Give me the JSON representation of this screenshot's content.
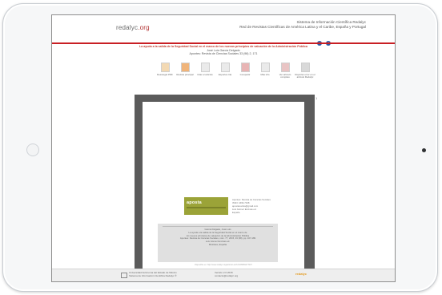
{
  "header": {
    "logo_prefix": "redalyc",
    "logo_suffix": ".org",
    "title_lines": [
      "Sistema de Información Científica Redalyc",
      "Red de Revistas Científicas de América Latina y el Caribe, España y Portugal"
    ],
    "social": [
      "t",
      "f"
    ]
  },
  "article": {
    "highlight": "La ayuda a la salida de la Seguridad Social en el marco de los nuevos principios de valuación de la Administración Pública",
    "author": "José Luis García Delgado",
    "source": "Apuntes: Revista de Ciencias Sociales 33 (98) 2, 171"
  },
  "toolbar": {
    "items": [
      {
        "label": "Descargar PDF",
        "icon": "pdf-download-icon"
      },
      {
        "label": "Revista principal",
        "icon": "journal-icon"
      },
      {
        "label": "Citar el artículo",
        "icon": "cite-icon"
      },
      {
        "label": "Exportar cita",
        "icon": "export-icon"
      },
      {
        "label": "Compartir",
        "icon": "share-icon"
      },
      {
        "label": "Más info",
        "icon": "info-icon"
      },
      {
        "label": "Ver artículo completo",
        "icon": "document-icon"
      },
      {
        "label": "Reportar error en el artículo Redalyc",
        "icon": "print-icon"
      }
    ]
  },
  "viewer": {
    "page_counter": "1",
    "card_brand": "aposta",
    "meta_lines": [
      "Apuntes: Revista de Ciencias Sociales",
      "ISSN: 1696-7348",
      "apostarevista@gmail.com",
      "Luis Gómez Encinas ed.",
      "España"
    ],
    "citation_lines": [
      "García Delgado, José Luis",
      "La ayuda a la salida de la Seguridad Social en el marco de",
      "los nuevos principios de valuación de la Administración Pública",
      "Apuntes: Revista de Ciencias Sociales, núm. 77, 2015, 33 (98), pp. 167-189",
      "Luis Gómez Encinas ed.",
      "Móstoles, España"
    ],
    "page_note": "Disponible en: http://www.redalyc.org/articulo.oa?id=495959477007"
  },
  "footer": {
    "left_lines": [
      "Universidad Autónoma del Estado de México",
      "Sistema de Información Científica Redalyc ®"
    ],
    "mid_lines": [
      "Versión 2.0 2018",
      "contacto@redalyc.org"
    ],
    "right": "redalyc",
    "right_accent": "#e39a1f"
  }
}
